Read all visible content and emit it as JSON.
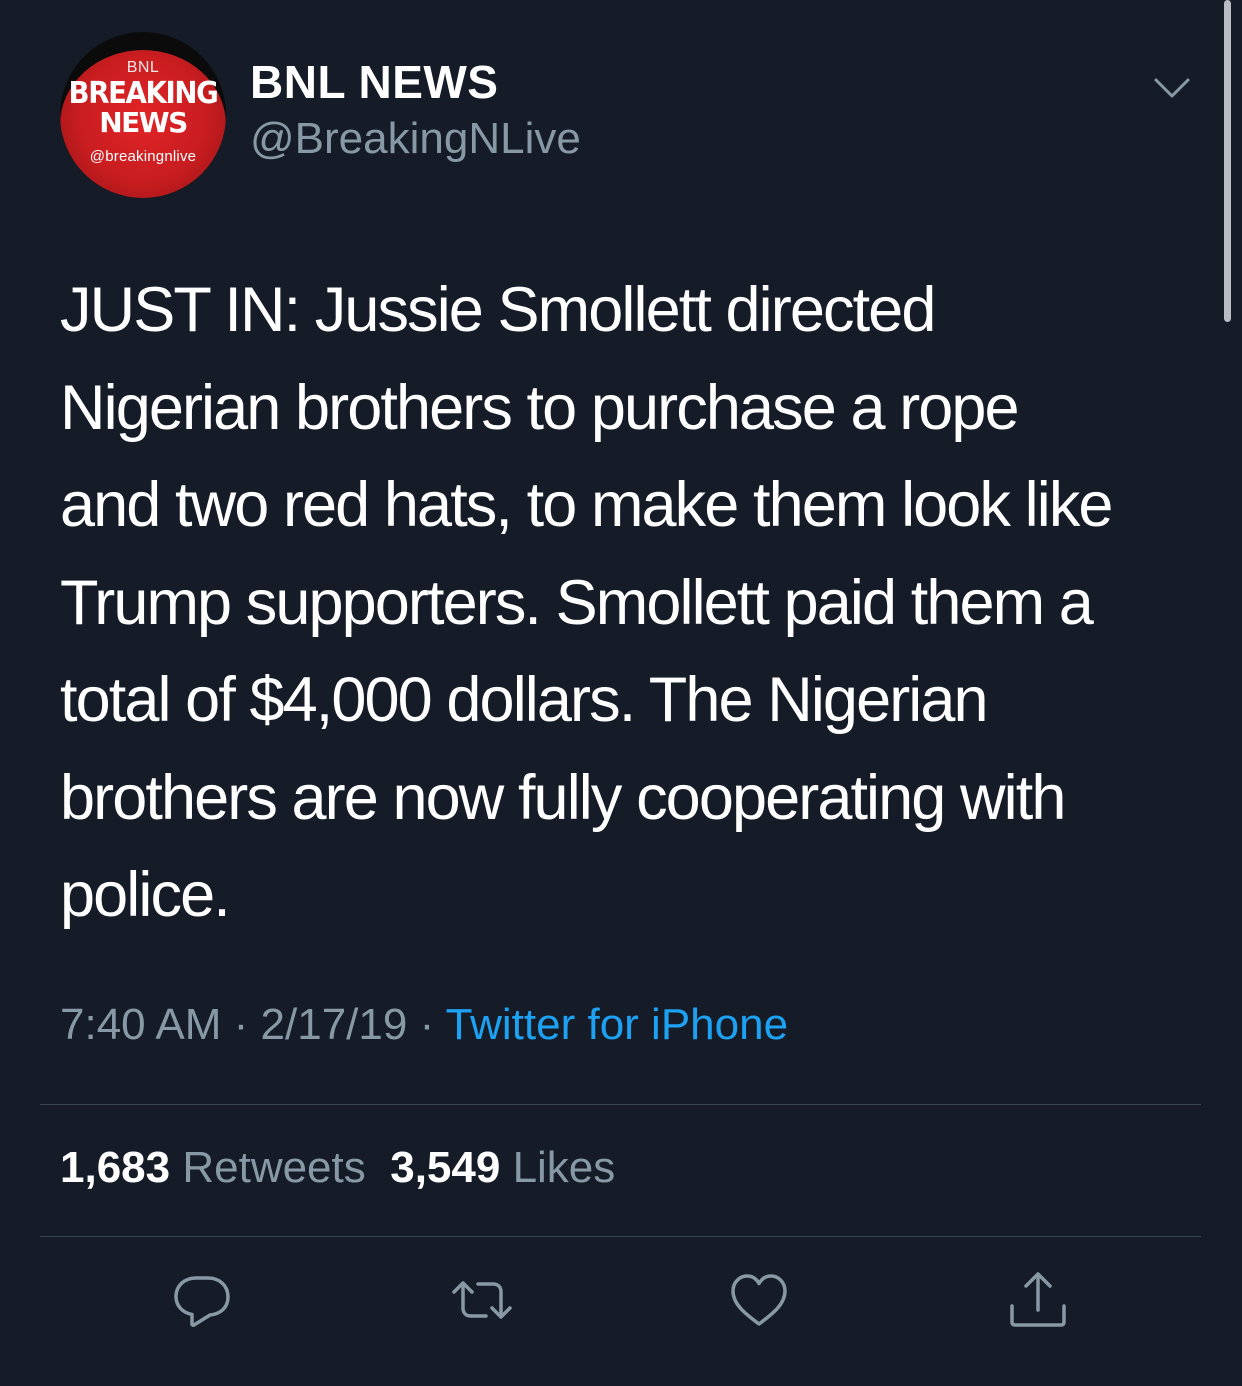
{
  "avatar": {
    "top_text": "BNL",
    "line1": "BREAKING",
    "line2": "NEWS",
    "handle_text": "@breakingnlive"
  },
  "header": {
    "display_name": "BNL NEWS",
    "screen_name": "@BreakingNLive"
  },
  "tweet": {
    "lines": [
      "JUST IN: Jussie Smollett directed",
      "Nigerian brothers to purchase a rope",
      "and two red hats, to make them look like",
      "Trump supporters. Smollett paid them a",
      "total of $4,000 dollars. The Nigerian",
      "brothers are now fully cooperating with",
      "police."
    ]
  },
  "meta": {
    "time": "7:40 AM",
    "sep1": " · ",
    "date": "2/17/19",
    "sep2": " · ",
    "source": "Twitter for iPhone"
  },
  "stats": {
    "retweets_count": "1,683",
    "retweets_label": "Retweets",
    "likes_count": "3,549",
    "likes_label": "Likes"
  },
  "actions": {
    "reply_icon": "reply-icon",
    "retweet_icon": "retweet-icon",
    "like_icon": "heart-icon",
    "share_icon": "share-icon"
  },
  "colors": {
    "background": "#151c27",
    "secondary_text": "#8899a6",
    "link": "#1da1f2",
    "divider": "#38444d"
  }
}
